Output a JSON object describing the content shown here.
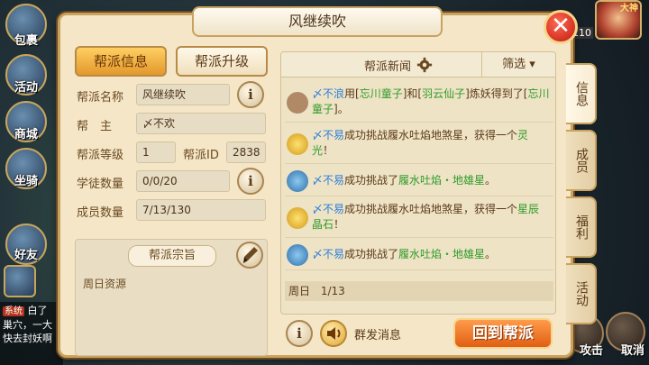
{
  "game_hud": {
    "left_buttons": [
      "包裹",
      "活动",
      "商城",
      "坐骑",
      "好友"
    ],
    "right_name": "大神",
    "right_level": "110",
    "chat_tag": "系统",
    "chat_lines": [
      "白了",
      "巢穴，一大",
      "快去封妖啊"
    ],
    "attack_label": "攻击",
    "cancel_label": "取消"
  },
  "dialog": {
    "title": "风继续吹",
    "close_symbol": "✕"
  },
  "left_panel": {
    "tab_info": "帮派信息",
    "tab_upgrade": "帮派升级",
    "fields": [
      {
        "label": "帮派名称",
        "value": "风继续吹"
      },
      {
        "label": "帮　主",
        "value": "〆不欢"
      },
      {
        "label": "帮派等级",
        "value": "1"
      },
      {
        "label": "学徒数量",
        "value": "0/0/20"
      },
      {
        "label": "成员数量",
        "value": "7/13/130"
      }
    ],
    "guild_id_label": "帮派ID",
    "guild_id_value": "2838",
    "info_symbol": "i",
    "purpose_title": "帮派宗旨",
    "purpose_text": "周日资源"
  },
  "news_panel": {
    "title": "帮派新闻",
    "filter": "筛选 ▾",
    "items": [
      {
        "name": "〆不浪",
        "pre": "用[",
        "item1": "忘川童子",
        "mid": "]和[",
        "item2": "羽云仙子",
        "post": "]炼妖得到了[",
        "item3": "忘川童子",
        "end": "]。"
      },
      {
        "name": "〆不易",
        "text": "成功挑战履水吐焰地煞星，获得一个",
        "reward": "灵光",
        "end": "！"
      },
      {
        "name": "〆不易",
        "text": "成功挑战了",
        "target": "履水吐焰・地雄星",
        "end": "。"
      },
      {
        "name": "〆不易",
        "text": "成功挑战履水吐焰地煞星，获得一个",
        "reward": "星辰晶石",
        "end": "！"
      },
      {
        "name": "〆不易",
        "text": "成功挑战了",
        "target": "履水吐焰・地雄星",
        "end": "。"
      }
    ],
    "day_label": "周日",
    "day_page": "1/13"
  },
  "bottom": {
    "info_symbol": "i",
    "broadcast_label": "群发消息",
    "return_label": "回到帮派"
  },
  "side_tabs": [
    "信息",
    "成员",
    "福利",
    "活动"
  ],
  "colors": {
    "name_blue": "#2c7fd8",
    "item_green": "#2f9b2a",
    "reward_orange": "#d48a14",
    "accent_orange": "#e05f14"
  }
}
